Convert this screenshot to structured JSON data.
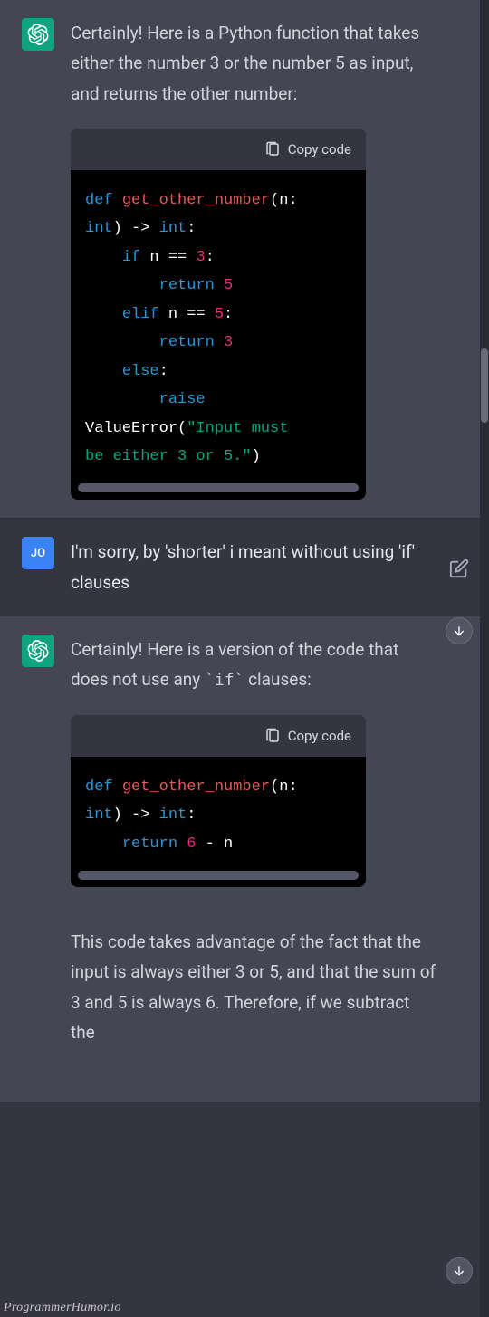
{
  "copy_label": "Copy code",
  "user_initials": "JO",
  "watermark": "ProgrammerHumor.io",
  "messages": {
    "m1_text": "Certainly! Here is a Python function that takes either the number 3 or the number 5 as input, and returns the other number:",
    "m2_text": "I'm sorry, by 'shorter' i meant without using 'if' clauses",
    "m3_pre": "Certainly! Here is a version of the code that does not use any ",
    "m3_code_inline": "`if`",
    "m3_post": " clauses:",
    "m3_followup": "This code takes advantage of the fact that the input is always either 3 or 5, and that the sum of 3 and 5 is always 6. Therefore, if we subtract the"
  },
  "code1": {
    "l1_def": "def",
    "l1_fn": "get_other_number",
    "l1_rest": "(n: \n",
    "l2_type": "int",
    "l2_arrow": ") -> ",
    "l2_type2": "int",
    "l2_colon": ":\n",
    "l3_pad": "    ",
    "l3_if": "if",
    "l3_rest": " n == ",
    "l3_num": "3",
    "l3_colon": ":\n",
    "l4_pad": "        ",
    "l4_ret": "return",
    "l4_sp": " ",
    "l4_num": "5",
    "l4_nl": "\n",
    "l5_pad": "    ",
    "l5_elif": "elif",
    "l5_rest": " n == ",
    "l5_num": "5",
    "l5_colon": ":\n",
    "l6_pad": "        ",
    "l6_ret": "return",
    "l6_sp": " ",
    "l6_num": "3",
    "l6_nl": "\n",
    "l7_pad": "    ",
    "l7_else": "else",
    "l7_colon": ":\n",
    "l8_pad": "        ",
    "l8_raise": "raise",
    "l8_nl": " \n",
    "l9_id": "ValueError",
    "l9_paren": "(",
    "l9_str": "\"Input must \nbe either 3 or 5.\"",
    "l9_close": ")"
  },
  "code2": {
    "l1_def": "def",
    "l1_fn": "get_other_number",
    "l1_rest": "(n: \n",
    "l2_type": "int",
    "l2_arrow": ") -> ",
    "l2_type2": "int",
    "l2_colon": ":\n",
    "l3_pad": "    ",
    "l3_ret": "return",
    "l3_sp": " ",
    "l3_num": "6",
    "l3_rest": " - n"
  }
}
